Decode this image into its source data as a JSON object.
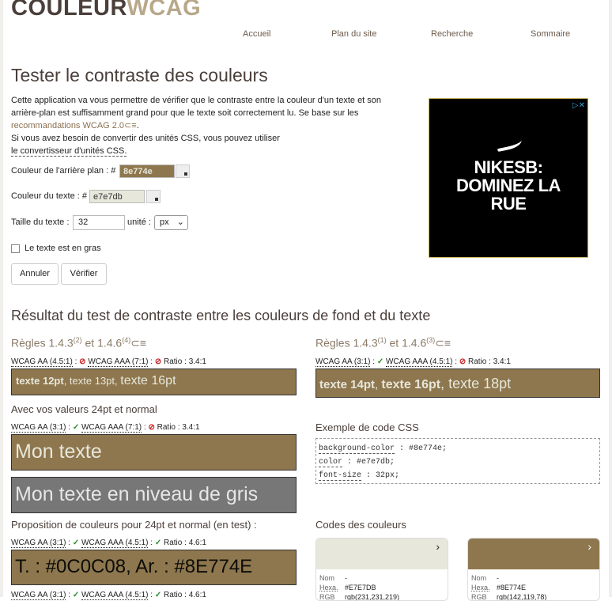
{
  "logo": {
    "part1": "COULEUR",
    "part2": "WCAG"
  },
  "nav": [
    "Accueil",
    "Plan du site",
    "Recherche",
    "Sommaire"
  ],
  "page_title": "Tester le contraste des couleurs",
  "intro": {
    "line1": "Cette application va vous permettre de vérifier que le contraste entre la couleur d'un texte et son",
    "line2": "arrière-plan est suffisamment grand pour que le texte soit correctement lu. Se base sur les",
    "link": "recommandations WCAG 2.0",
    "link_suffix": "⊂≡",
    "line4": "Si vous avez besoin de convertir des unités CSS, vous pouvez utiliser",
    "line5": "le convertisseur d'unités CSS."
  },
  "form": {
    "bg_label": "Couleur de l'arrière plan : #",
    "bg_value": "8e774e",
    "text_label": "Couleur du texte : #",
    "text_value": "e7e7db",
    "size_label": "Taille du texte :",
    "size_value": "32",
    "unit_label": "unité :",
    "unit_value": "px",
    "bold_label": "Le texte est en gras",
    "cancel": "Annuler",
    "verify": "Vérifier"
  },
  "ad": {
    "close": "▷✕",
    "line1": "NIKESB:",
    "line2": "DOMINEZ LA",
    "line3": "RUE"
  },
  "result_title": "Résultat du test de contraste entre les couleurs de fond et du texte",
  "left_rules": {
    "t1": "Règles 1.4.3",
    "s1": "(2)",
    "t2": " et 1.4.6",
    "s2": "(4)",
    "icon": "⊂≡"
  },
  "right_rules": {
    "t1": "Règles 1.4.3",
    "s1": "(1)",
    "t2": " et 1.4.6",
    "s2": "(3)",
    "icon": "⊂≡"
  },
  "left_wcag": {
    "aa": "WCAG AA (4.5:1)",
    "aaa": "WCAG AAA (7:1)",
    "ratio": "Ratio",
    "ratio_val": "3.4:1"
  },
  "right_wcag": {
    "aa": "WCAG AA (3:1)",
    "aaa": "WCAG AAA (4.5:1)",
    "ratio": "Ratio",
    "ratio_val": "3.4:1"
  },
  "left_sample": {
    "a": "texte 12pt",
    "b": ", texte 13pt, ",
    "c": "texte 16pt"
  },
  "right_sample": {
    "a": "texte 14pt",
    "b": ", ",
    "c": "texte 16pt",
    "d": ", texte 18pt"
  },
  "your_values": {
    "title": "Avec vos valeurs 24pt et normal",
    "aa": "WCAG AA (3:1)",
    "aaa": "WCAG AAA (7:1)",
    "ratio": "Ratio",
    "ratio_val": "3.4:1"
  },
  "sample_text": "Mon texte",
  "sample_gray": "Mon texte en niveau de gris",
  "css_title": "Exemple de code CSS",
  "css": {
    "l1k": "background-color",
    "l1v": " : #8e774e;",
    "l2k": "color",
    "l2v": " : #e7e7db;",
    "l3k": "font-size",
    "l3v": " : 32px;"
  },
  "proposal": {
    "title": "Proposition de couleurs pour 24pt et normal (en test) :",
    "aa": "WCAG AA (3:1)",
    "aaa": "WCAG AAA (4.5:1)",
    "ratio": "Ratio",
    "ratio_val": "4.6:1",
    "text": "T. : #0C0C08, Ar. : #8E774E",
    "aa2": "WCAG AA (3:1)",
    "aaa2": "WCAG AAA (4.5:1)",
    "ratio2": "Ratio",
    "ratio_val2": "4.6:1"
  },
  "codes_title": "Codes des couleurs",
  "card1": {
    "nom_k": "Nom",
    "nom_v": "-",
    "hex_k": "Hexa.",
    "hex_v": "#E7E7DB",
    "rgb_k": "RGB",
    "rgb_v": "rgb(231,231,219)"
  },
  "card2": {
    "nom_k": "Nom",
    "nom_v": "-",
    "hex_k": "Hexa.",
    "hex_v": "#8E774E",
    "rgb_k": "RGB",
    "rgb_v": "rgb(142,119,78)"
  },
  "colors": {
    "bg": "#8e774e",
    "fg": "#e7e7db",
    "gray": "#777777"
  }
}
